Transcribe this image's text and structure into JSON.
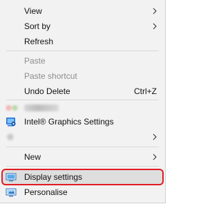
{
  "menu": {
    "items": [
      {
        "label": "View",
        "has_submenu": true
      },
      {
        "label": "Sort by",
        "has_submenu": true
      },
      {
        "label": "Refresh"
      },
      {
        "label": "Paste",
        "disabled": true
      },
      {
        "label": "Paste shortcut",
        "disabled": true
      },
      {
        "label": "Undo Delete",
        "shortcut": "Ctrl+Z"
      },
      {
        "label": "",
        "blurred": true
      },
      {
        "label": "Intel® Graphics Settings",
        "icon": "intel-graphics-icon"
      },
      {
        "label": "",
        "blurred": true,
        "has_submenu": true
      },
      {
        "label": "New",
        "has_submenu": true
      },
      {
        "label": "Display settings",
        "icon": "display-icon",
        "highlighted": true
      },
      {
        "label": "Personalise",
        "icon": "personalise-icon"
      }
    ]
  },
  "colors": {
    "menu_bg": "#f2f2f2",
    "highlight_border": "#e01b22",
    "disabled_text": "#8d8d8d"
  }
}
